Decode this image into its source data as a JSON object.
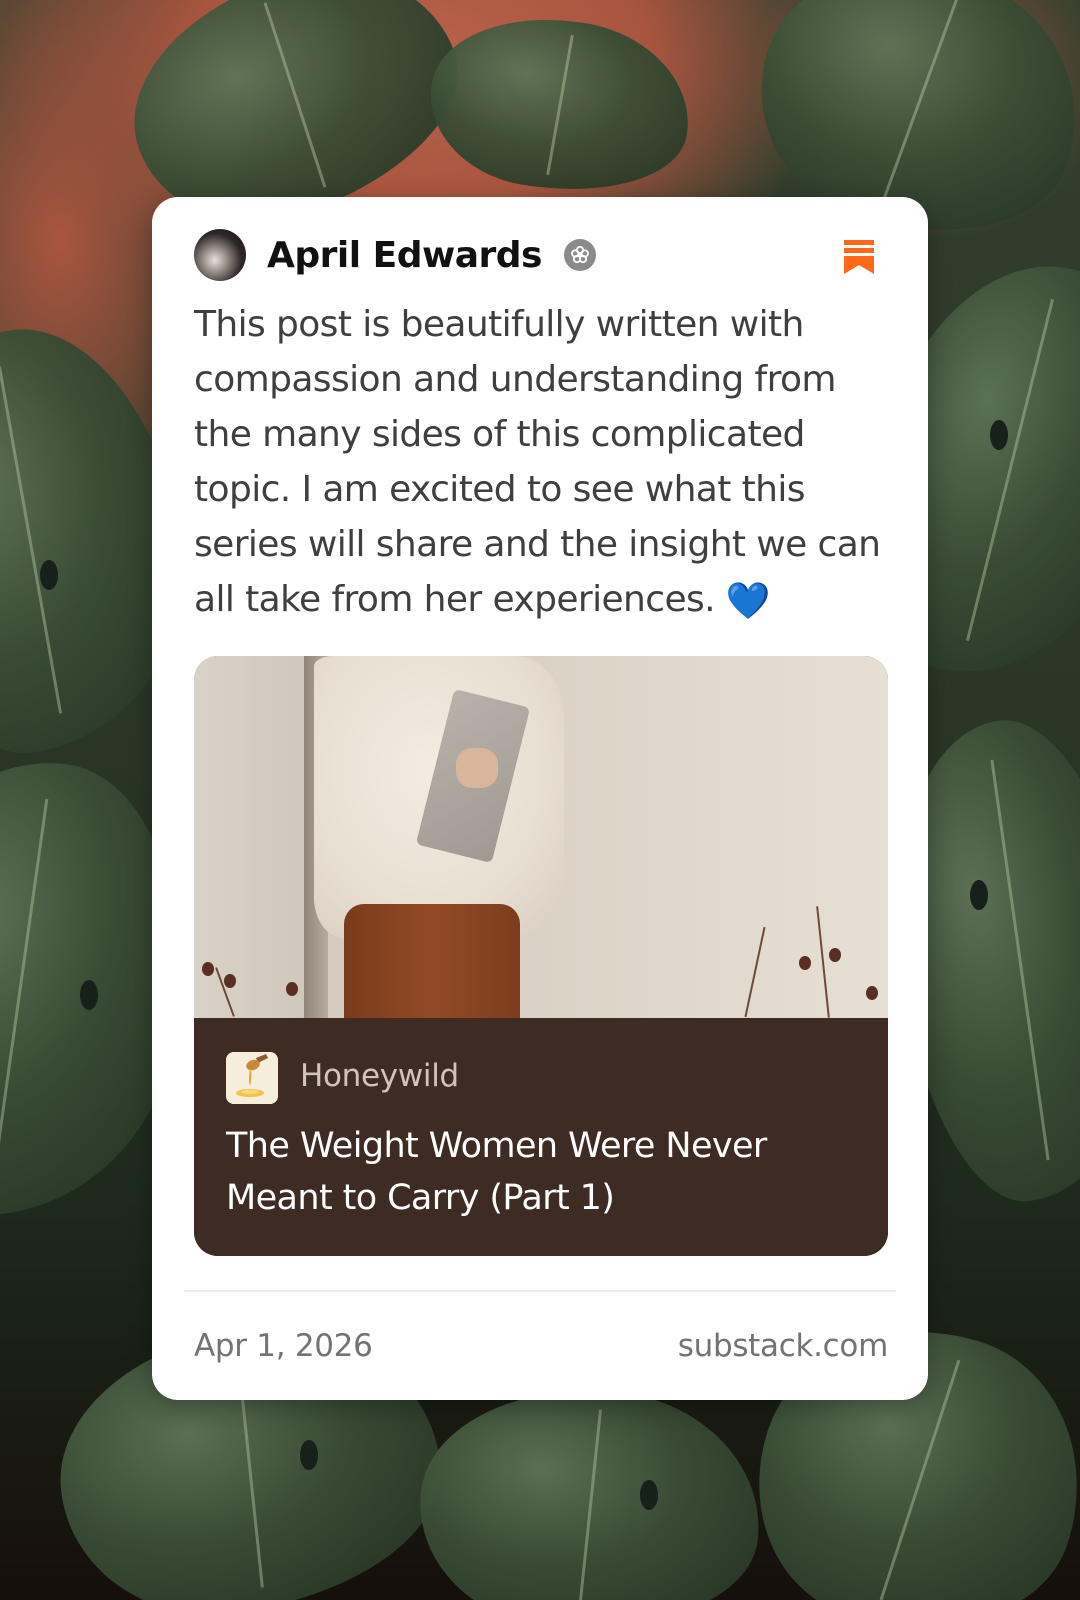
{
  "comment": {
    "author_name": "April Edwards",
    "author_avatar_icon": "avatar-photo",
    "verified_badge_icon": "flower-badge-icon",
    "bookmark_icon": "bookmark-icon",
    "text": "This post is beautifully written with compassion and understanding from the many sides of this complicated topic. I am excited to see what this series will share and the insight we can all take from her experiences.",
    "emoji": "💙"
  },
  "post": {
    "publication_name": "Honeywild",
    "publication_logo_icon": "honey-dipper-icon",
    "title": "The Weight Women Were Never Meant to Carry (Part 1)"
  },
  "footer": {
    "date": "Apr 1, 2026",
    "source": "substack.com"
  },
  "colors": {
    "accent": "#FF6719",
    "post_info_bg": "#3D2B24",
    "card_bg": "#FFFFFF"
  }
}
